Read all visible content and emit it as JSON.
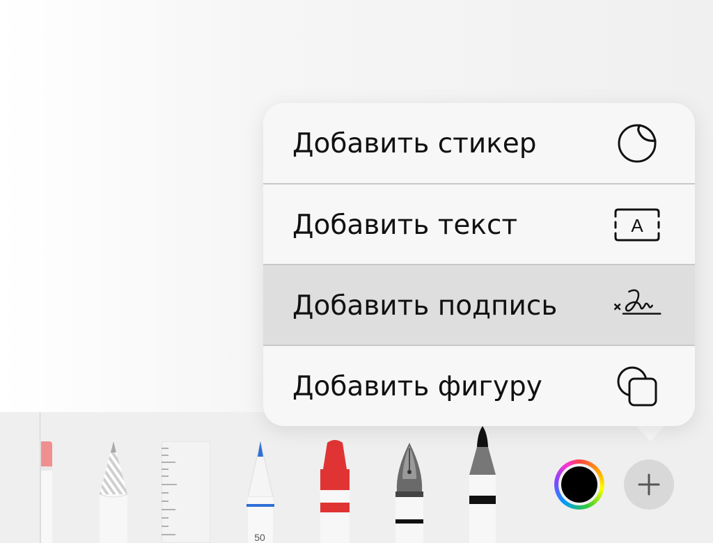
{
  "menu": {
    "items": [
      {
        "label": "Добавить стикер",
        "icon": "sticker-icon",
        "highlighted": false
      },
      {
        "label": "Добавить текст",
        "icon": "text-box-icon",
        "highlighted": false
      },
      {
        "label": "Добавить подпись",
        "icon": "signature-icon",
        "highlighted": true
      },
      {
        "label": "Добавить фигуру",
        "icon": "shapes-icon",
        "highlighted": false
      }
    ]
  },
  "toolbar": {
    "tools": [
      {
        "name": "eraser",
        "icon": "eraser-icon"
      },
      {
        "name": "pencil",
        "icon": "pencil-icon"
      },
      {
        "name": "ruler",
        "icon": "ruler-icon"
      },
      {
        "name": "marker-blue",
        "icon": "marker-icon",
        "size_label": "50",
        "accent": "#2f6fd6"
      },
      {
        "name": "crayon-red",
        "icon": "crayon-icon",
        "accent": "#e03434"
      },
      {
        "name": "fountain-pen",
        "icon": "fountain-pen-icon"
      },
      {
        "name": "felt-pen",
        "icon": "felt-pen-icon"
      }
    ],
    "current_color": "#000000",
    "add_icon": "plus-icon"
  }
}
